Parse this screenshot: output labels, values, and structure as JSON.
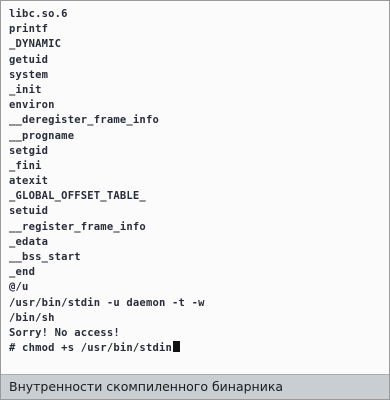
{
  "terminal": {
    "lines": [
      "libc.so.6",
      "printf",
      "_DYNAMIC",
      "getuid",
      "system",
      "_init",
      "environ",
      "__deregister_frame_info",
      "__progname",
      "setgid",
      "_fini",
      "atexit",
      "_GLOBAL_OFFSET_TABLE_",
      "setuid",
      "__register_frame_info",
      "_edata",
      "__bss_start",
      "_end",
      "@/u",
      "/usr/bin/stdin -u daemon -t -w",
      "/bin/sh",
      "Sorry! No access!",
      "# chmod +s /usr/bin/stdin"
    ]
  },
  "caption": {
    "text": "Внутренности скомпиленного бинарника"
  }
}
